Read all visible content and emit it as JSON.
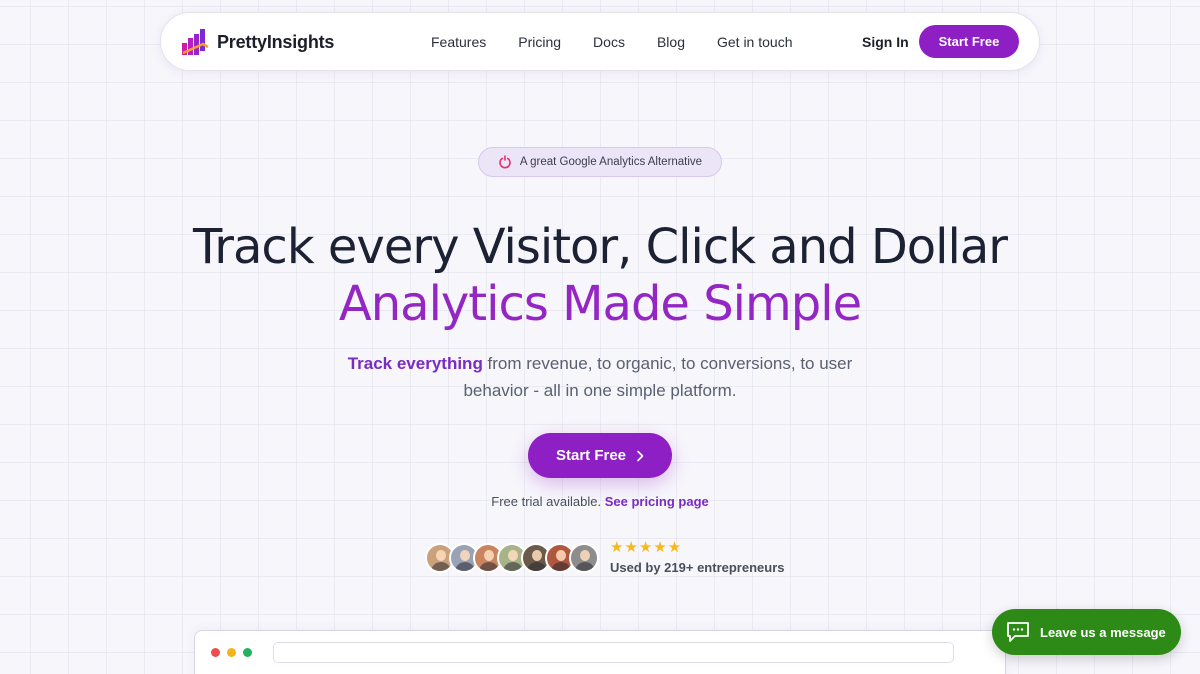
{
  "nav": {
    "brand": "PrettyInsights",
    "links": [
      "Features",
      "Pricing",
      "Docs",
      "Blog",
      "Get in touch"
    ],
    "sign_in": "Sign In",
    "cta": "Start Free"
  },
  "badge": {
    "text": "A great Google Analytics Alternative",
    "icon": "power-icon"
  },
  "hero": {
    "title_line1": "Track every Visitor, Click and Dollar",
    "title_line2": "Analytics Made Simple",
    "subtitle_highlight": "Track everything",
    "subtitle_rest": " from revenue, to organic, to conversions, to user behavior - all in one simple platform.",
    "cta": "Start Free",
    "cta_icon": "chevron-right-icon",
    "trial_text": "Free trial available. ",
    "trial_link": "See pricing page"
  },
  "social_proof": {
    "avatar_count": 7,
    "avatar_colors": [
      "#c9a27c",
      "#9aa3b5",
      "#c98460",
      "#a8b38a",
      "#6b5a4a",
      "#b0573f",
      "#8d8d8d"
    ],
    "stars": "★★★★★",
    "rating": 5,
    "used_by": "Used by 219+ entrepreneurs"
  },
  "chat": {
    "label": "Leave us a message",
    "icon": "chat-bubble-icon"
  },
  "colors": {
    "brand": "#8e1fc4",
    "headline": "#1c2233",
    "accent_text": "#9426c4",
    "chat": "#2e8a16",
    "stars": "#f6b91b"
  }
}
